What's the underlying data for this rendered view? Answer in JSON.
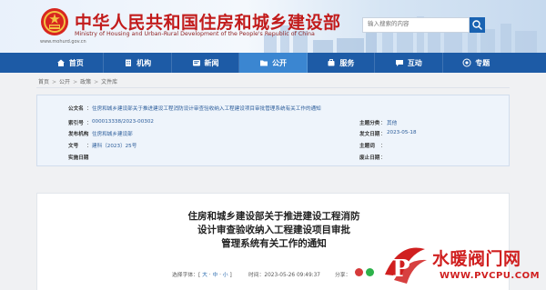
{
  "header": {
    "title_cn": "中华人民共和国住房和城乡建设部",
    "title_en": "Ministry of Housing and Urban-Rural Development of the People's Republic of China",
    "domain": "www.mohurd.gov.cn",
    "search_placeholder": "输入搜索的内容"
  },
  "nav": [
    {
      "label": "首页",
      "icon": "home-icon"
    },
    {
      "label": "机构",
      "icon": "building-icon"
    },
    {
      "label": "新闻",
      "icon": "news-icon"
    },
    {
      "label": "公开",
      "icon": "folder-icon",
      "active": true
    },
    {
      "label": "服务",
      "icon": "service-icon"
    },
    {
      "label": "互动",
      "icon": "chat-icon"
    },
    {
      "label": "专题",
      "icon": "topic-icon"
    }
  ],
  "breadcrumb": [
    "首页",
    "公开",
    "政策",
    "文件库"
  ],
  "meta": {
    "index_label": "公文名",
    "index_value": "住房和城乡建设部关于推进建设工程消防设计审查验收纳入工程建设项目审批管理系统有关工作的通知",
    "index_no_label": "索引号",
    "index_no_value": "000013338/2023-00302",
    "subject_label": "主题分类",
    "subject_value": "其他",
    "publisher_label": "发布机构",
    "publisher_value": "住房和城乡建设部",
    "pubdate_label": "发文日期",
    "pubdate_value": "2023-05-18",
    "docno_label": "文号",
    "docno_value": "建科〔2023〕25号",
    "keyword_label": "主题词",
    "keyword_value": "",
    "impl_label": "实施日期",
    "impl_value": "",
    "abolish_label": "废止日期",
    "abolish_value": ""
  },
  "article": {
    "title_lines": [
      "住房和城乡建设部关于推进建设工程消防",
      "设计审查验收纳入工程建设项目审批",
      "管理系统有关工作的通知"
    ],
    "font_label": "选择字体：",
    "size_big": "大",
    "size_mid": "中",
    "size_small": "小",
    "time_label": "时间：",
    "time_value": "2023-05-26 09:49:37",
    "share_label": "分享："
  },
  "watermark": {
    "text": "水暖阀门网",
    "url": "WWW.PVCPU.COM"
  },
  "colors": {
    "brand_red": "#c21c1c",
    "nav_blue": "#1d5ba6",
    "nav_active": "#3b86d1",
    "link_blue": "#2b5c9a"
  }
}
